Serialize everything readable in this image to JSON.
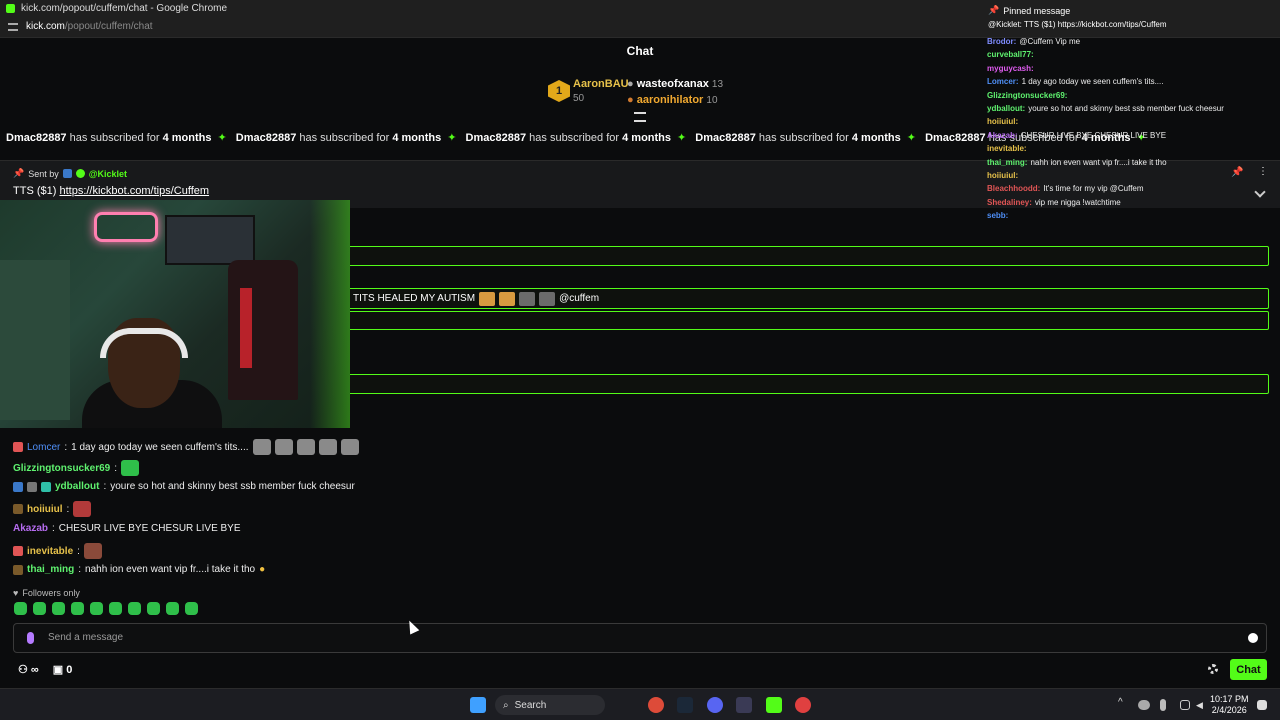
{
  "window": {
    "title": "kick.com/popout/cuffem/chat - Google Chrome",
    "url_host": "kick.com",
    "url_path": "/popout/cuffem/chat"
  },
  "chat_header": {
    "title": "Chat"
  },
  "leaderboard": {
    "rank": "1",
    "top": {
      "name": "AaronBAU",
      "count": "50"
    },
    "second": {
      "name": "wasteofxanax",
      "count": "13"
    },
    "third": {
      "name": "aaronihilator",
      "count": "10"
    }
  },
  "ticker": {
    "user": "Dmac82887",
    "text": "has subscribed for",
    "months": "4 months"
  },
  "pinned": {
    "sent_by_label": "Sent by",
    "sender": "@Kicklet",
    "text": "TTS ($1)",
    "link": "https://kickbot.com/tips/Cuffem"
  },
  "highlight_msg": {
    "text": "TITS HEALED MY AUTISM",
    "mention": "@cuffem"
  },
  "messages": [
    {
      "user": "Lomcer",
      "user_color": "#4f8ff7",
      "text": "1 day ago today we seen cuffem's tits...."
    },
    {
      "user": "Glizzingtonsucker69",
      "user_color": "#5ff26f",
      "text": ""
    },
    {
      "user": "ydballout",
      "user_color": "#5ff26f",
      "text": "youre so hot and skinny best ssb member fuck cheesur"
    },
    {
      "user": "hoiiuiul",
      "user_color": "#e6c14a",
      "text": ""
    },
    {
      "user": "Akazab",
      "user_color": "#b66cf0",
      "text": "CHESUR LIVE BYE CHESUR LIVE BYE"
    },
    {
      "user": "inevitable",
      "user_color": "#e6c14a",
      "text": ""
    },
    {
      "user": "thai_ming",
      "user_color": "#5ff26f",
      "text": "nahh ion even want vip fr....i take it tho"
    }
  ],
  "followers_only": "Followers only",
  "input": {
    "placeholder": "Send a message"
  },
  "bottom": {
    "points": "0",
    "chat_button": "Chat"
  },
  "taskbar": {
    "search": "Search",
    "time": "10:17 PM",
    "date": "2/4/2026"
  },
  "overlay": {
    "pinned_title": "Pinned message",
    "pinned_text": "@Kicklet: TTS ($1) https://kickbot.com/tips/Cuffem",
    "lines": [
      {
        "user": "Brodor",
        "color": "#7f8cff",
        "text": "@Cuffem Vip me"
      },
      {
        "user": "curveball77",
        "color": "#5ff26f",
        "text": ""
      },
      {
        "user": "myguycash",
        "color": "#e05cf0",
        "text": ""
      },
      {
        "user": "Lomcer",
        "color": "#4f8ff7",
        "text": "1 day ago today we seen cuffem's tits...."
      },
      {
        "user": "Glizzingtonsucker69",
        "color": "#5ff26f",
        "text": ""
      },
      {
        "user": "ydballout",
        "color": "#5ff26f",
        "text": "youre so hot and skinny best ssb member fuck cheesur"
      },
      {
        "user": "hoiiuiul",
        "color": "#e6c14a",
        "text": ""
      },
      {
        "user": "Akazab",
        "color": "#b66cf0",
        "text": "CHESUR LIVE BYE CHESUR LIVE BYE"
      },
      {
        "user": "inevitable",
        "color": "#e6c14a",
        "text": ""
      },
      {
        "user": "thai_ming",
        "color": "#5ff26f",
        "text": "nahh ion even want vip fr....i take it tho"
      },
      {
        "user": "hoiiuiul",
        "color": "#e6c14a",
        "text": ""
      },
      {
        "user": "Bleachhoodd",
        "color": "#e05555",
        "text": "It's time for my vip @Cuffem"
      },
      {
        "user": "Shedaliney",
        "color": "#e05555",
        "text": "vip me nigga !watchtime"
      },
      {
        "user": "sebb",
        "color": "#4f8ff7",
        "text": ""
      }
    ]
  },
  "colors": {
    "kick_green": "#53fc18",
    "background": "#0b0c0d"
  }
}
